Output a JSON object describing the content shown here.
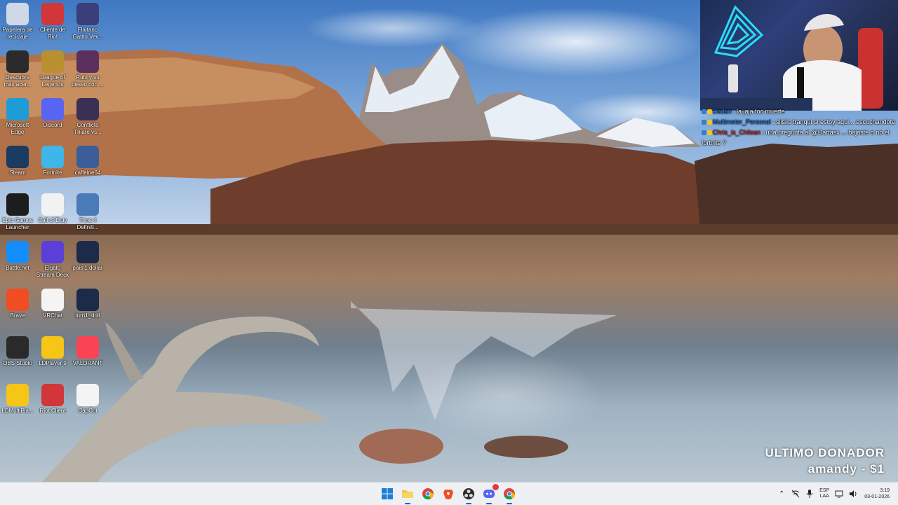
{
  "desktop": {
    "icons": [
      {
        "id": "recycle-bin",
        "label": "Papelera de\nreciclaje",
        "icon": "recycle-bin-icon",
        "color": "#cfd8e6"
      },
      {
        "id": "riot-client-top",
        "label": "Cliente de\nRiot",
        "icon": "riot-fist-icon",
        "color": "#d13639"
      },
      {
        "id": "flaitano",
        "label": "Flaitano\nGatito Vev...",
        "icon": "game-shortcut-icon",
        "color": "#3a3f7a"
      },
      {
        "id": "xbox",
        "label": "Descubre\nmás acer...",
        "icon": "xbox-icon",
        "color": "#2b2b2b"
      },
      {
        "id": "lol",
        "label": "League of\nLegends",
        "icon": "league-icon",
        "color": "#b8902f"
      },
      {
        "id": "rubi",
        "label": "Rubi y su\ndeseo con ...",
        "icon": "game-shortcut-icon",
        "color": "#5b2f5e"
      },
      {
        "id": "edge",
        "label": "Microsoft\nEdge",
        "icon": "edge-icon",
        "color": "#1f9bd6"
      },
      {
        "id": "discord",
        "label": "Discord",
        "icon": "discord-icon",
        "color": "#5865f2"
      },
      {
        "id": "conflicto",
        "label": "Conflicto\nThiare vs...",
        "icon": "game-shortcut-icon",
        "color": "#3a3055"
      },
      {
        "id": "steam",
        "label": "Steam",
        "icon": "steam-icon",
        "color": "#1b3b60"
      },
      {
        "id": "fortnite",
        "label": "Fortnite",
        "icon": "fortnite-icon",
        "color": "#3fb6e8"
      },
      {
        "id": "caffeine",
        "label": "caffeine64",
        "icon": "coffee-cup-icon",
        "color": "#3b5e9a"
      },
      {
        "id": "epic",
        "label": "Epic Games\nLauncher",
        "icon": "epic-games-icon",
        "color": "#1d1d1d"
      },
      {
        "id": "cod",
        "label": "Call of Duty",
        "icon": "document-icon",
        "color": "#f2f2f2"
      },
      {
        "id": "trine",
        "label": "Trine 4\nDefiniti...",
        "icon": "trine-icon",
        "color": "#4b7ab8"
      },
      {
        "id": "battlenet",
        "label": "Battle.net",
        "icon": "battlenet-icon",
        "color": "#148eff"
      },
      {
        "id": "streamdeck",
        "label": "Elgato\nStream Deck",
        "icon": "stream-deck-icon",
        "color": "#5a3fd8"
      },
      {
        "id": "pais",
        "label": "pais 1 dollar",
        "icon": "video-file-icon",
        "color": "#1c2b4a"
      },
      {
        "id": "brave",
        "label": "Brave",
        "icon": "brave-lion-icon",
        "color": "#f04d23"
      },
      {
        "id": "vrchat",
        "label": "VRChat",
        "icon": "vrchat-icon",
        "color": "#f4f4f4"
      },
      {
        "id": "turn",
        "label": "turn1_doll",
        "icon": "video-file-icon",
        "color": "#1c2b4a"
      },
      {
        "id": "obs",
        "label": "OBS Studio",
        "icon": "obs-icon",
        "color": "#2a2a2a"
      },
      {
        "id": "ldplayer",
        "label": "LDPlayer 9",
        "icon": "ldplayer-icon",
        "color": "#f5c518"
      },
      {
        "id": "valorant",
        "label": "VALORANT",
        "icon": "valorant-icon",
        "color": "#fa4454"
      },
      {
        "id": "ldmulti",
        "label": "LDMultiPla...",
        "icon": "ldmultiplayer-icon",
        "color": "#f5c518"
      },
      {
        "id": "riot-client",
        "label": "Riot Client",
        "icon": "riot-fist-icon",
        "color": "#d13639"
      },
      {
        "id": "capcut",
        "label": "CapCut",
        "icon": "capcut-icon",
        "color": "#f4f4f4"
      }
    ]
  },
  "chat": {
    "messages": [
      {
        "user": "Dadan",
        "text": " : la jaja toc muerte",
        "user_color": "#2f7fd8"
      },
      {
        "user": "Multimeter_Personal",
        "text": " : siisiis tranqui si estoy aqui... escuchandote",
        "user_color": "#2f7fd8"
      },
      {
        "user": "Chris_is_Chilean",
        "text": " : una pregunta al @Dartasx ... bajaste o no el fortnite ?",
        "user_color": "#e0352b"
      }
    ]
  },
  "donor": {
    "title": "ULTIMO DONADOR",
    "name_amount": "amandy - $1"
  },
  "taskbar": {
    "apps": [
      {
        "name": "start-button",
        "icon": "windows-logo-icon",
        "active": false
      },
      {
        "name": "file-explorer",
        "icon": "folder-icon",
        "active": true
      },
      {
        "name": "chrome",
        "icon": "chrome-icon",
        "active": false
      },
      {
        "name": "brave",
        "icon": "brave-lion-icon",
        "active": false
      },
      {
        "name": "obs",
        "icon": "obs-icon",
        "active": true
      },
      {
        "name": "discord",
        "icon": "discord-icon",
        "active": true,
        "badge": "99+"
      },
      {
        "name": "chrome-alt",
        "icon": "chrome-icon",
        "active": true
      }
    ],
    "tray": {
      "language_top": "ESP",
      "language_bottom": "LAA",
      "time": "3:19",
      "date": "03-01-2026"
    }
  }
}
